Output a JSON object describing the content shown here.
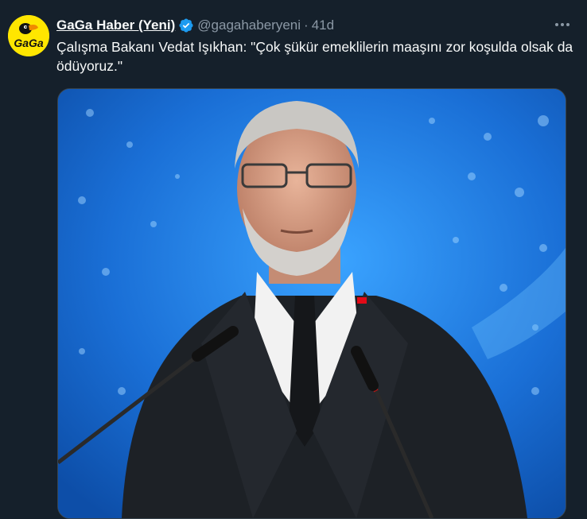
{
  "tweet": {
    "author_name": "GaGa Haber (Yeni)",
    "handle": "@gagahaberyeni",
    "separator": "·",
    "time": "41d",
    "text": "Çalışma Bakanı Vedat Işıkhan: \"Çok şükür emeklilerin maaşını zor koşulda olsak da ödüyoruz.\"",
    "avatar_logo_text": "GaGa"
  },
  "colors": {
    "background": "#15202b",
    "verified": "#1d9bf0",
    "avatar_bg": "#ffe600",
    "secondary_text": "#8b98a5"
  }
}
